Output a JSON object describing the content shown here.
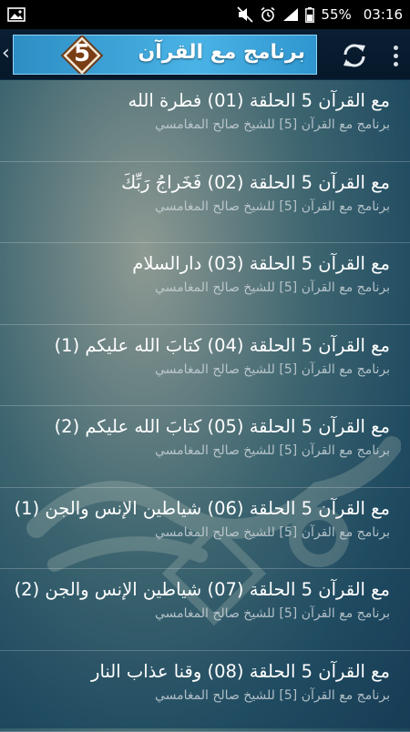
{
  "status_bar": {
    "battery": "55%",
    "time": "03:16"
  },
  "app_bar": {
    "banner_title": "برنامج مع القرآن",
    "banner_number": "5",
    "back_icon": "chevron-left-icon",
    "refresh_icon": "refresh-icon",
    "menu_icon": "overflow-menu-icon"
  },
  "episodes": [
    {
      "title": "مع القرآن 5 الحلقة (01) فطرة الله",
      "subtitle": "برنامج مع القرآن [5] للشيخ صالح المغامسي"
    },
    {
      "title": "مع القرآن 5 الحلقة (02) فَخَراجُ رَبِّكَ",
      "subtitle": "برنامج مع القرآن [5] للشيخ صالح المغامسي"
    },
    {
      "title": "مع القرآن 5 الحلقة (03) دارالسلام",
      "subtitle": "برنامج مع القرآن [5] للشيخ صالح المغامسي"
    },
    {
      "title": "مع القرآن 5 الحلقة (04) كتابَ الله عليكم (1)",
      "subtitle": "برنامج مع القرآن [5] للشيخ صالح المغامسي"
    },
    {
      "title": "مع القرآن 5 الحلقة (05) كتابَ الله عليكم (2)",
      "subtitle": "برنامج مع القرآن [5] للشيخ صالح المغامسي"
    },
    {
      "title": "مع القرآن 5 الحلقة (06) شياطين الإنس والجن (1)",
      "subtitle": "برنامج مع القرآن [5] للشيخ صالح المغامسي"
    },
    {
      "title": "مع القرآن 5 الحلقة (07) شياطين الإنس والجن (2)",
      "subtitle": "برنامج مع القرآن [5] للشيخ صالح المغامسي"
    },
    {
      "title": "مع القرآن 5 الحلقة (08) وقنا عذاب النار",
      "subtitle": "برنامج مع القرآن [5] للشيخ صالح المغامسي"
    }
  ]
}
